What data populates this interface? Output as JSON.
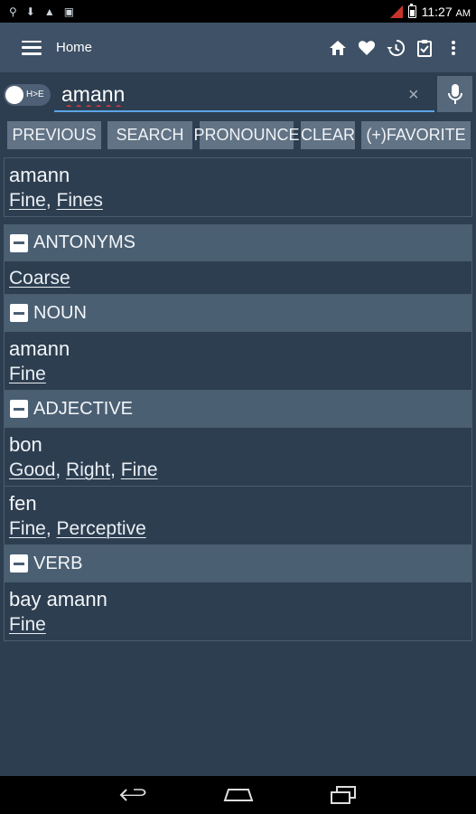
{
  "status_bar": {
    "time": "11:27",
    "ampm": "AM"
  },
  "toolbar": {
    "title": "Home",
    "icons": [
      "menu-icon",
      "home-icon",
      "heart-icon",
      "history-icon",
      "clipboard-icon",
      "overflow-menu-icon"
    ]
  },
  "search": {
    "toggle_label": "H>E",
    "query": "amann",
    "clear_glyph": "×"
  },
  "buttons": {
    "previous": "PREVIOUS",
    "search": "SEARCH",
    "pronounce": "PRONOUNCE",
    "clear": "CLEAR",
    "favorite": "(+)FAVORITE"
  },
  "results": {
    "main": {
      "word": "amann",
      "links": [
        "Fine",
        "Fines"
      ]
    },
    "antonyms": {
      "header": "ANTONYMS",
      "links": [
        "Coarse"
      ]
    },
    "noun": {
      "header": "NOUN",
      "entries": [
        {
          "word": "amann",
          "links": [
            "Fine"
          ]
        }
      ]
    },
    "adjective": {
      "header": "ADJECTIVE",
      "entries": [
        {
          "word": "bon",
          "links": [
            "Good",
            "Right",
            "Fine"
          ]
        },
        {
          "word": "fen",
          "links": [
            "Fine",
            "Perceptive"
          ]
        }
      ]
    },
    "verb": {
      "header": "VERB",
      "entries": [
        {
          "word": "bay amann",
          "links": [
            "Fine"
          ]
        }
      ]
    }
  },
  "colors": {
    "background": "#2d3e50",
    "toolbar": "#3e5166",
    "button": "#617385",
    "section_header": "#4b5f73",
    "search_underline": "#5aa4e6"
  }
}
